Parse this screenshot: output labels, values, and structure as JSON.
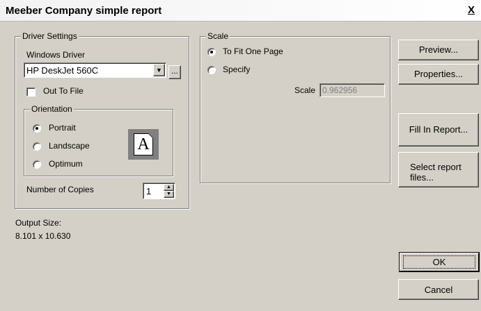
{
  "window": {
    "title": "Meeber Company simple report",
    "close_label": "X"
  },
  "driver_settings": {
    "group_label": "Driver Settings",
    "windows_driver_label": "Windows Driver",
    "driver_value": "HP DeskJet 560C",
    "browse_label": "...",
    "out_to_file_label": "Out To File",
    "out_to_file_checked": false,
    "orientation": {
      "group_label": "Orientation",
      "options": [
        "Portrait",
        "Landscape",
        "Optimum"
      ],
      "selected": "Portrait",
      "icon_letter": "A"
    },
    "copies_label": "Number of Copies",
    "copies_value": "1"
  },
  "output": {
    "label": "Output Size:",
    "value": "8.101 x 10.630"
  },
  "scale": {
    "group_label": "Scale",
    "options": [
      "To Fit One Page",
      "Specify"
    ],
    "selected": "To Fit One Page",
    "scale_label": "Scale",
    "scale_value": "0.962956"
  },
  "buttons": {
    "preview": "Preview...",
    "properties": "Properties...",
    "fill_in_report": "Fill In Report...",
    "select_files_line1": "Select report",
    "select_files_line2": "files...",
    "ok": "OK",
    "cancel": "Cancel"
  },
  "colors": {
    "dialog_bg": "#d4d0c8",
    "titlebar_bg": "#ffffff"
  }
}
